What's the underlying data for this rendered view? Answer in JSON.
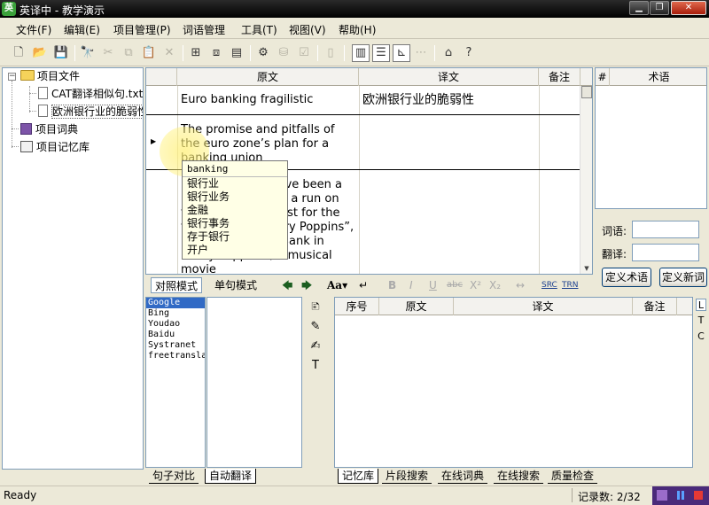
{
  "window": {
    "title": "英译中 - 教学演示",
    "app_icon": "英",
    "minimize": "▁",
    "maximize": "❐",
    "close": "✕"
  },
  "menu": [
    "文件(F)",
    "编辑(E)",
    "项目管理(P)",
    "词语管理",
    "工具(T)",
    "视图(V)",
    "帮助(H)"
  ],
  "toolbar_icons": [
    "new-icon",
    "open-icon",
    "save-icon",
    "find-icon",
    "cut-icon",
    "copy-icon",
    "paste-icon",
    "delete-icon",
    "import-icon",
    "export-icon",
    "convert-icon",
    "settings-icon",
    "memory-icon",
    "check-icon",
    "layout-icon",
    "view-side-icon",
    "view-stack-icon",
    "view-grid-icon",
    "view-split-icon",
    "home-icon",
    "help-icon"
  ],
  "tree": {
    "project_files": "项目文件",
    "file1": "CAT翻译相似句.txt",
    "file2": "欧洲银行业的脆弱性",
    "dictionary": "项目词典",
    "memory": "项目记忆库"
  },
  "grid": {
    "headers": {
      "source": "原文",
      "target": "译文",
      "note": "备注"
    },
    "rows": [
      {
        "source": "Euro banking fragilistic",
        "target": "欧洲银行业的脆弱性",
        "note": ""
      },
      {
        "source": "The promise and pitfalls of the euro zone’s plan for a banking union",
        "target": "",
        "note": ""
      },
      {
        "source": "RECENT weeks have been a reminder that “it’s a run on the bank” is not just for the tales of Tomes Mary Poppins”, Fidelity Fiduciary Bank in “Mary Poppins”, a musical movie",
        "target": "",
        "note": ""
      }
    ]
  },
  "popup": {
    "query": "banking",
    "suggestions": [
      "银行业",
      "银行业务",
      "金融",
      "银行事务",
      "存于银行",
      "开户"
    ]
  },
  "terms": {
    "headers": {
      "num": "#",
      "term": "术语"
    },
    "word_label": "词语:",
    "translation_label": "翻译:",
    "define_term": "定义术语",
    "define_new": "定义新词"
  },
  "editbar": {
    "compare_mode": "对照模式",
    "single_mode": "单句模式",
    "font_label": "Aa▾",
    "src_label": "SRC",
    "trn_label": "TRN"
  },
  "engines": [
    "Google",
    "Bing",
    "Youdao",
    "Baidu",
    "Systranet",
    "freetranslation"
  ],
  "memory_grid": {
    "headers": {
      "num": "序号",
      "source": "原文",
      "target": "译文",
      "note": "备注"
    }
  },
  "side_letters": [
    "L",
    "T",
    "C"
  ],
  "bottom_tabs_left": [
    "句子对比",
    "自动翻译"
  ],
  "bottom_tabs_right": [
    "记忆库",
    "片段搜索",
    "在线词典",
    "在线搜索",
    "质量检查"
  ],
  "status": {
    "text": "Ready",
    "record_count": "记录数: 2/32"
  },
  "colors": {
    "selection": "#316ac5",
    "popup_bg": "#ffffe6",
    "accent_purple": "#4a2a7a"
  }
}
